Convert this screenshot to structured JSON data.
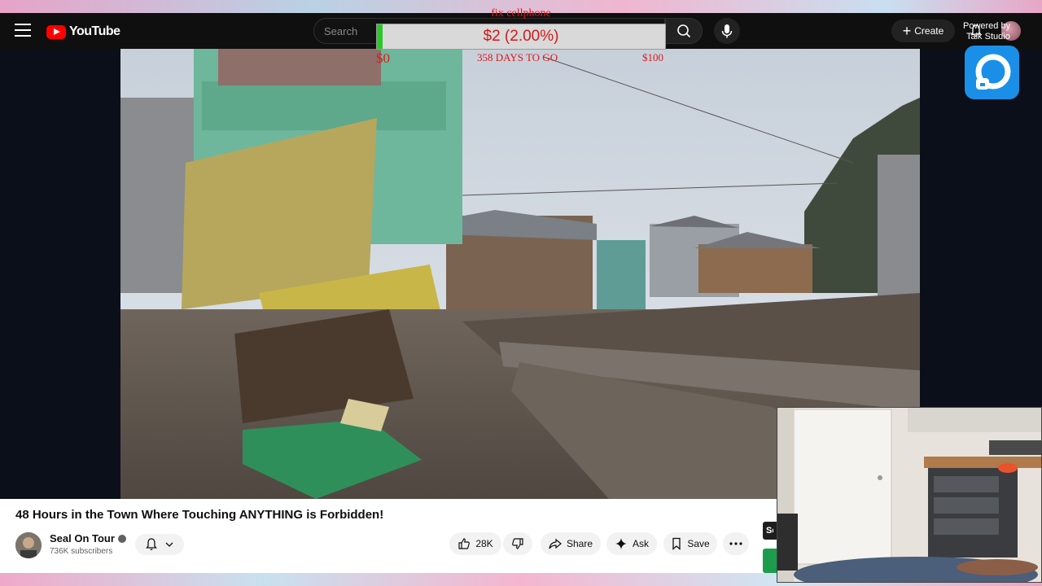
{
  "header": {
    "logo_text": "YouTube",
    "search_placeholder": "Search",
    "create_label": "Create"
  },
  "goal_overlay": {
    "title": "fix cellphone",
    "amount": "$2 (2.00%)",
    "progress_fraction": 0.02,
    "start_label": "$0",
    "days_label": "358 DAYS TO GO",
    "end_label": "$100"
  },
  "branding": {
    "powered_by": "Powered by",
    "studio": "Talk Studio"
  },
  "video": {
    "title": "48 Hours in the Town Where Touching ANYTHING is Forbidden!"
  },
  "channel": {
    "name": "Seal On Tour",
    "subscribers": "736K subscribers"
  },
  "actions": {
    "likes": "28K",
    "share": "Share",
    "ask": "Ask",
    "save": "Save"
  },
  "side_chip": "Sea",
  "colors": {
    "youtube_red": "#ff0000",
    "goal_red": "#e01818",
    "goal_green": "#2cc72c",
    "talk_studio_blue": "#1a8fe8"
  }
}
